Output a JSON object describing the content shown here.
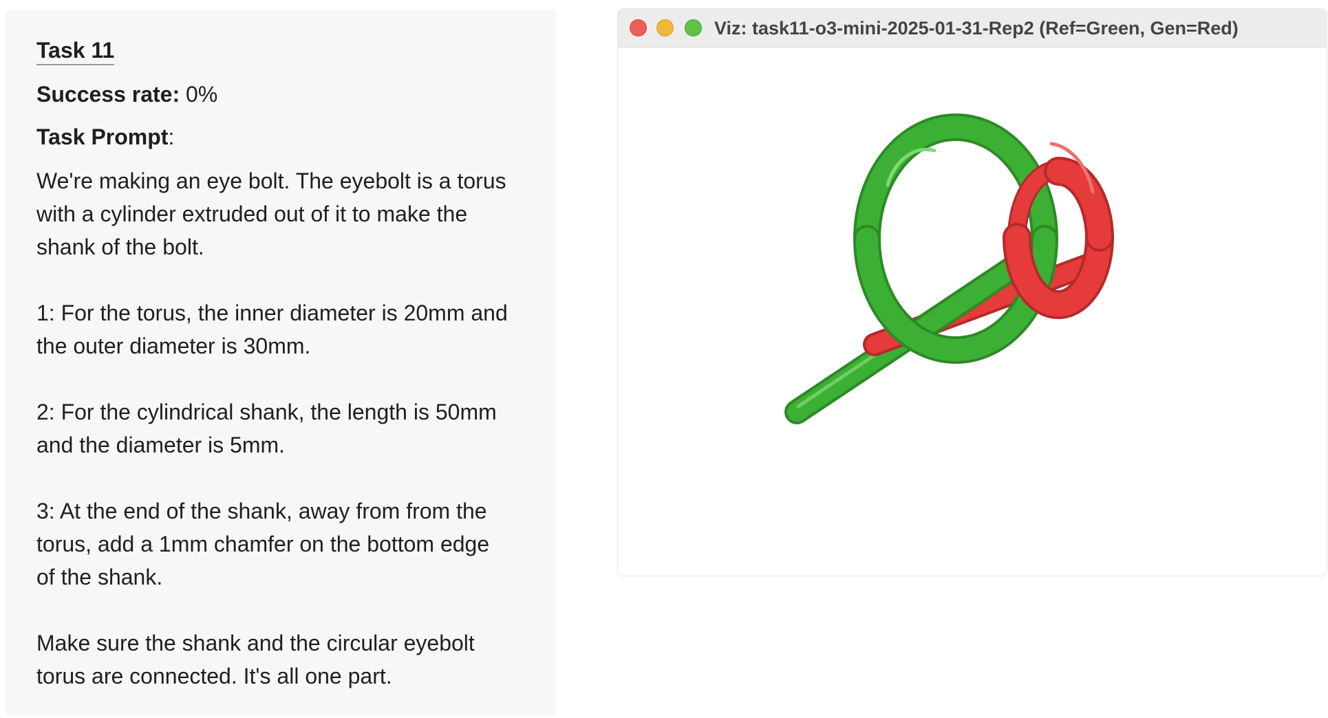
{
  "task": {
    "title": "Task 11",
    "success_label": "Success rate:",
    "success_value": "0%",
    "prompt_label": "Task Prompt",
    "prompt_colon": ":",
    "paragraphs": [
      "We're making an eye bolt. The eyebolt is a torus\nwith a cylinder extruded out of it to make the\nshank of the bolt.",
      "1: For the torus, the inner diameter is 20mm and\nthe outer diameter is 30mm.",
      "2: For the cylindrical shank, the length is 50mm\nand the diameter is 5mm.",
      "3: At the end of the shank, away from from the\ntorus, add a 1mm chamfer on the bottom edge\nof the shank.",
      "Make sure the shank and the circular eyebolt\ntorus are connected. It's all one part."
    ]
  },
  "viz_window": {
    "title": "Viz: task11-o3-mini-2025-01-31-Rep2 (Ref=Green, Gen=Red)",
    "buttons": {
      "close": "close-icon",
      "minimize": "minimize-icon",
      "maximize": "maximize-icon"
    },
    "model_colors": {
      "reference": "#3cb034",
      "generated": "#e53b3b"
    }
  }
}
